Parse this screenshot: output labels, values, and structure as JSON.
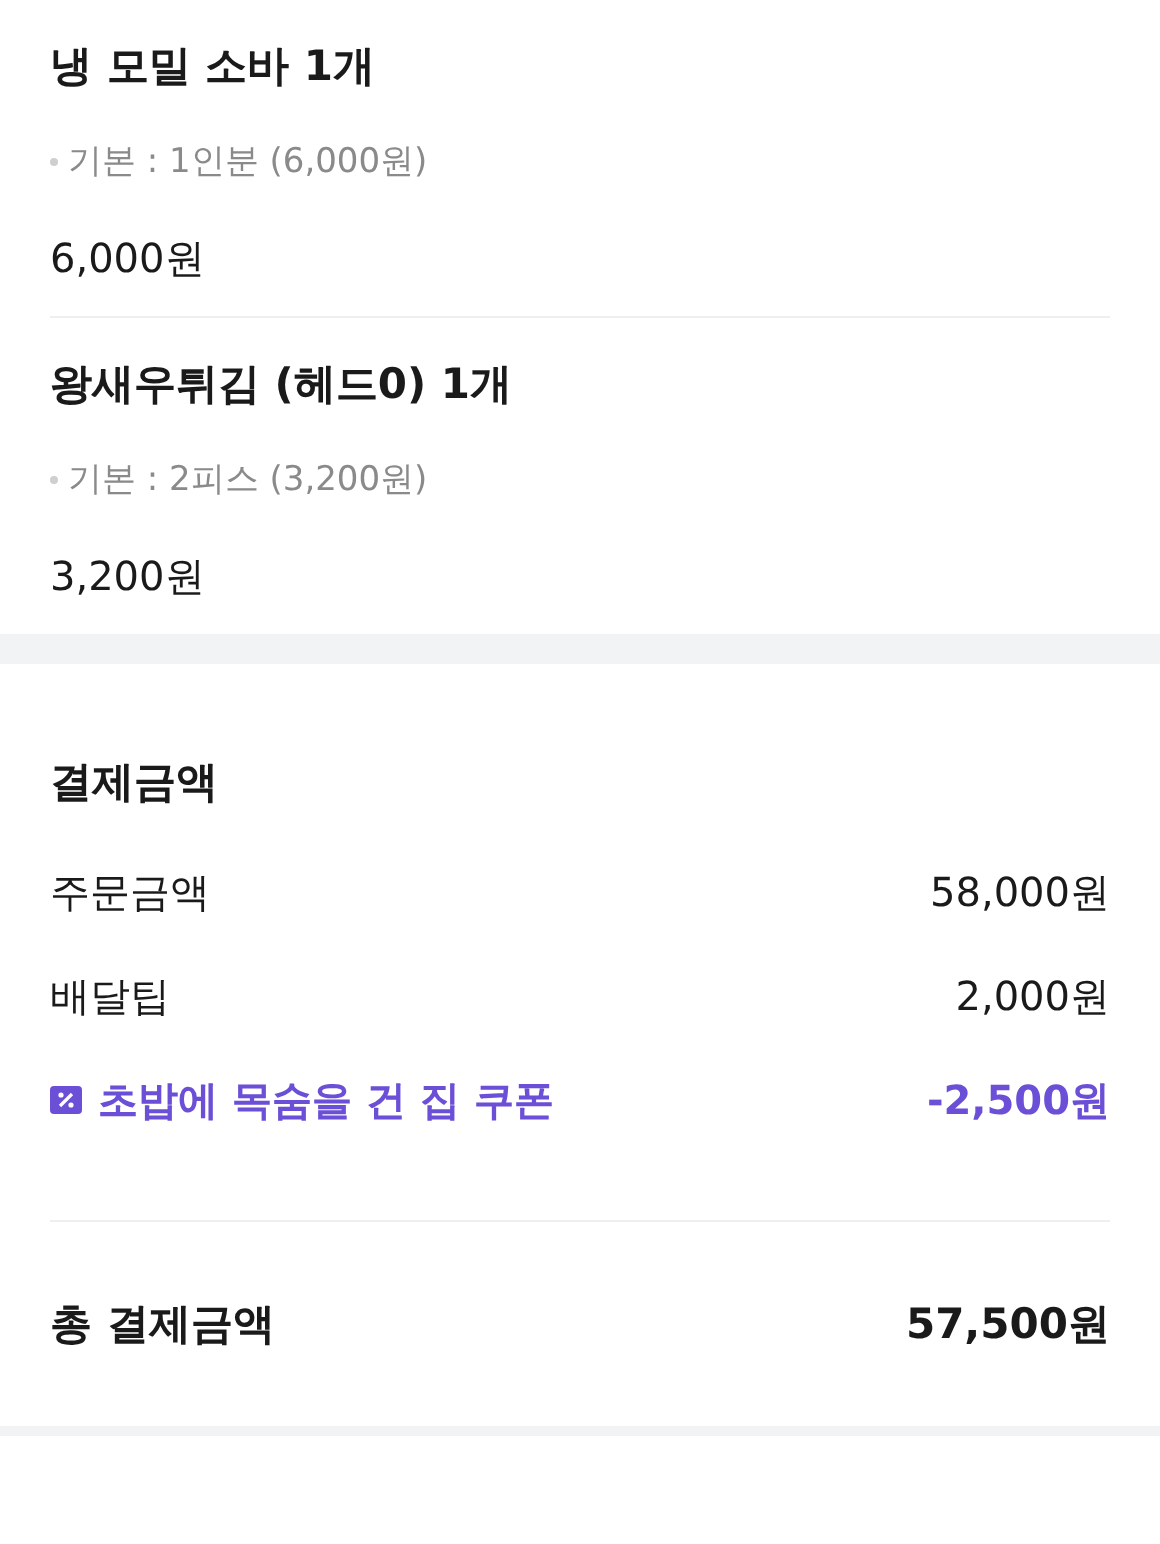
{
  "order_items": [
    {
      "name": "냉 모밀 소바 1개",
      "option": "기본 : 1인분 (6,000원)",
      "price": "6,000원"
    },
    {
      "name": "왕새우튀김 (헤드0) 1개",
      "option": "기본 : 2피스 (3,200원)",
      "price": "3,200원"
    }
  ],
  "payment": {
    "title": "결제금액",
    "rows": [
      {
        "kind": "normal",
        "label": "주문금액",
        "amount": "58,000원"
      },
      {
        "kind": "normal",
        "label": "배달팁",
        "amount": "2,000원"
      },
      {
        "kind": "coupon",
        "label": "초밥에 목숨을 건 집 쿠폰",
        "amount": "-2,500원"
      }
    ],
    "total": {
      "label": "총 결제금액",
      "amount": "57,500원"
    }
  }
}
